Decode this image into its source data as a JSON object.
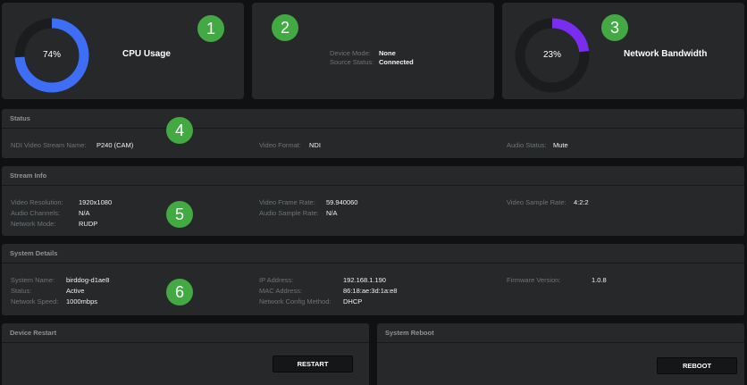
{
  "cpu": {
    "percent_label": "74%",
    "percent": 74,
    "title": "CPU Usage",
    "color": "#3d6ef5"
  },
  "device": {
    "mode_label": "Device Mode:",
    "mode_value": "None",
    "source_label": "Source Status:",
    "source_value": "Connected"
  },
  "network": {
    "percent_label": "23%",
    "percent": 23,
    "title": "Network Bandwidth",
    "color": "#7a2df0"
  },
  "badges": [
    "1",
    "2",
    "3",
    "4",
    "5",
    "6"
  ],
  "status": {
    "title": "Status",
    "ndi_label": "NDI Video Stream Name:",
    "ndi_value": "P240 (CAM)",
    "format_label": "Video Format:",
    "format_value": "NDI",
    "audio_label": "Audio Status:",
    "audio_value": "Mute"
  },
  "stream": {
    "title": "Stream Info",
    "res_label": "Video Resolution:",
    "res_value": "1920x1080",
    "ch_label": "Audio Channels:",
    "ch_value": "N/A",
    "mode_label": "Network Mode:",
    "mode_value": "RUDP",
    "fps_label": "Video Frame Rate:",
    "fps_value": "59.940060",
    "asr_label": "Audio Sample Rate:",
    "asr_value": "N/A",
    "vsr_label": "Video Sample Rate:",
    "vsr_value": "4:2:2"
  },
  "system": {
    "title": "System Details",
    "name_label": "System Name:",
    "name_value": "birddog-d1ae8",
    "status_label": "Status:",
    "status_value": "Active",
    "speed_label": "Network Speed:",
    "speed_value": "1000mbps",
    "ip_label": "IP Address:",
    "ip_value": "192.168.1.190",
    "mac_label": "MAC Address:",
    "mac_value": "86:18:ae:3d:1a:e8",
    "cfg_label": "Network Config Method:",
    "cfg_value": "DHCP",
    "fw_label": "Firmware Version:",
    "fw_value": "1.0.8"
  },
  "restart": {
    "title": "Device Restart",
    "button": "RESTART"
  },
  "reboot": {
    "title": "System Reboot",
    "button": "REBOOT"
  }
}
